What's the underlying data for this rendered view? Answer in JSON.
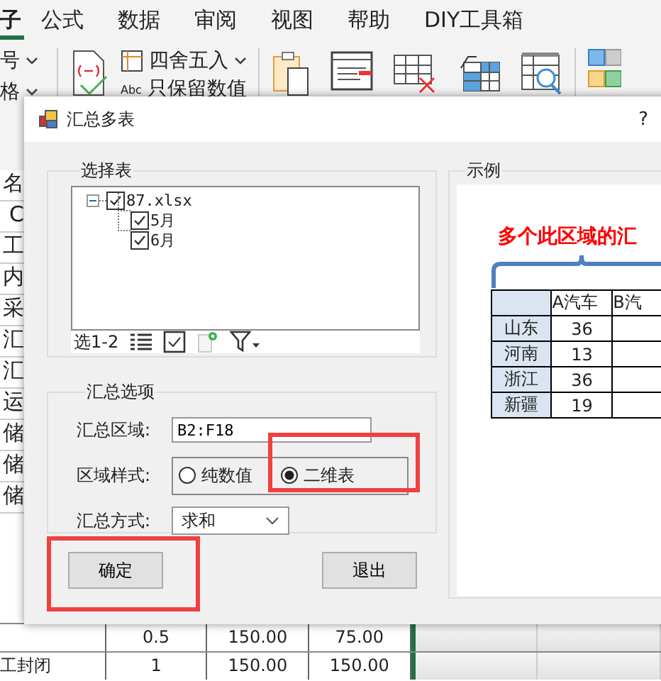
{
  "ribbon_tabs": [
    {
      "label": "子",
      "selected": true
    },
    {
      "label": "公式",
      "selected": false
    },
    {
      "label": "数据",
      "selected": false
    },
    {
      "label": "审阅",
      "selected": false
    },
    {
      "label": "视图",
      "selected": false
    },
    {
      "label": "帮助",
      "selected": false
    },
    {
      "label": "DIY工具箱",
      "selected": false
    }
  ],
  "ribbon": {
    "left_items": [
      "号",
      "格"
    ],
    "round_button": "四舍五入",
    "values_badge": "Abc",
    "values_button": "只保留数值"
  },
  "sheet": {
    "left_cells": [
      "名",
      "C",
      "工",
      "内",
      "采",
      "汇",
      "汇",
      "运",
      "储",
      "储",
      "储"
    ],
    "rows": [
      {
        "values": [
          "0.5",
          "150.00",
          "75.00"
        ]
      },
      {
        "label": "工封闭",
        "values": [
          "1",
          "150.00",
          "150.00"
        ]
      }
    ]
  },
  "dialog": {
    "title": "汇总多表",
    "help": "?",
    "select_group": {
      "title": "选择表",
      "tree": [
        {
          "label": "87.xlsx",
          "checked": true,
          "expanded": true,
          "children": [
            {
              "label": "5月",
              "checked": true
            },
            {
              "label": "6月",
              "checked": true
            }
          ]
        }
      ],
      "range_label": "选1-2"
    },
    "options_group": {
      "title": "汇总选项",
      "area_label": "汇总区域:",
      "area_value": "B2:F18",
      "style_label": "区域样式:",
      "styles": [
        {
          "label": "纯数值",
          "selected": false,
          "highlighted": false
        },
        {
          "label": "二维表",
          "selected": true,
          "highlighted": true
        }
      ],
      "method_label": "汇总方式:",
      "method_value": "求和"
    },
    "example_group": {
      "title": "示例",
      "caption": "多个此区域的汇",
      "columns": [
        "A汽车",
        "B汽"
      ],
      "rows": [
        {
          "name": "山东",
          "values": [
            "36"
          ]
        },
        {
          "name": "河南",
          "values": [
            "13"
          ]
        },
        {
          "name": "浙江",
          "values": [
            "36"
          ]
        },
        {
          "name": "新疆",
          "values": [
            "19"
          ]
        }
      ]
    },
    "buttons": [
      {
        "label": "确定",
        "highlighted": true
      },
      {
        "label": "退出",
        "highlighted": false
      }
    ]
  }
}
